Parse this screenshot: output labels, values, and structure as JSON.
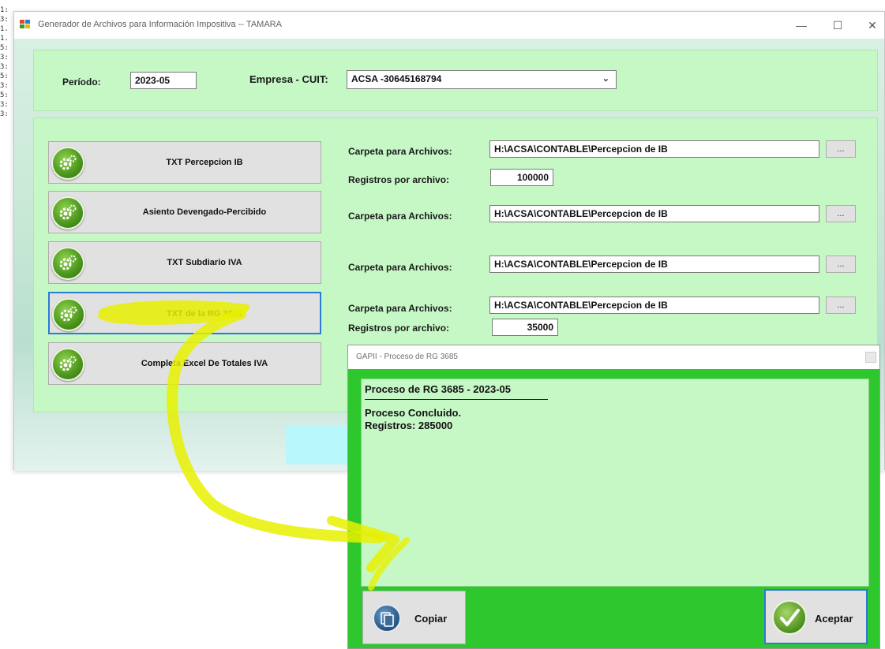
{
  "background_console": {
    "lines": [
      "1:",
      "3:",
      "1.",
      "1.",
      "5:",
      "3:",
      "3:",
      "5:",
      "3:",
      "5:",
      "3:",
      "3:"
    ]
  },
  "window": {
    "title": "Generador de Archivos para Información Impositiva  --  TAMARA",
    "minimize": "—",
    "maximize": "☐",
    "close": "✕"
  },
  "top_panel": {
    "periodo_label": "Período:",
    "periodo_value": "2023-05",
    "empresa_label": "Empresa - CUIT:",
    "empresa_value": "ACSA  -30645168794"
  },
  "actions": [
    {
      "label": "TXT Percepcion IB",
      "carpeta_label": "Carpeta para Archivos:",
      "carpeta_value": "H:\\ACSA\\CONTABLE\\Percepcion de IB",
      "registros_label": "Registros por archivo:",
      "registros_value": "100000"
    },
    {
      "label": "Asiento Devengado-Percibido",
      "carpeta_label": "Carpeta para Archivos:",
      "carpeta_value": "H:\\ACSA\\CONTABLE\\Percepcion de IB"
    },
    {
      "label": "TXT Subdiario IVA",
      "carpeta_label": "Carpeta para Archivos:",
      "carpeta_value": "H:\\ACSA\\CONTABLE\\Percepcion de IB"
    },
    {
      "label": "TXT de la RG 3685",
      "carpeta_label": "Carpeta para Archivos:",
      "carpeta_value": "H:\\ACSA\\CONTABLE\\Percepcion de IB",
      "registros_label": "Registros por archivo:",
      "registros_value": "35000"
    },
    {
      "label": "Completa Excel De Totales IVA"
    }
  ],
  "browse_label": "...",
  "dialog": {
    "title": "GAPII - Proceso de RG 3685",
    "heading": "Proceso de RG 3685 - 2023-05",
    "line1": "Proceso Concluido.",
    "line2": "Registros: 285000",
    "copy_label": "Copiar",
    "ok_label": "Aceptar"
  },
  "colors": {
    "panel": "#c6f8c6",
    "dialog_frame": "#2ec82e",
    "annotation": "#e8f000"
  },
  "icons": {
    "action": "gears-icon",
    "copy": "clipboard-icon",
    "ok": "checkmark-icon"
  }
}
